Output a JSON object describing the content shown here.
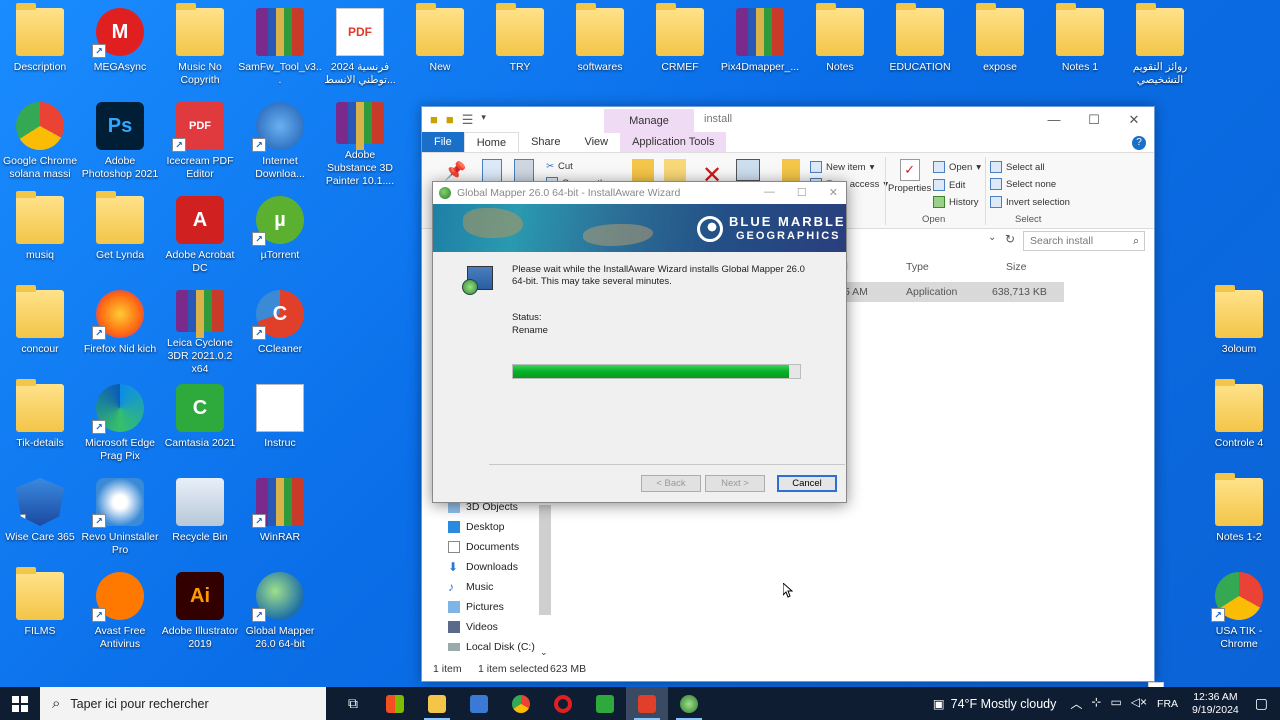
{
  "desktop": {
    "icons": [
      {
        "label": "Description",
        "kind": "folder",
        "shortcut": false
      },
      {
        "label": "MEGAsync",
        "kind": "mega",
        "shortcut": true
      },
      {
        "label": "Music No Copyrith",
        "kind": "folder",
        "shortcut": false
      },
      {
        "label": "SamFw_Tool_v3...",
        "kind": "rar",
        "shortcut": false
      },
      {
        "label": "فرنسية 2024 توطني الانسط...",
        "kind": "pdf",
        "shortcut": false
      },
      {
        "label": "New",
        "kind": "folder",
        "shortcut": false
      },
      {
        "label": "TRY",
        "kind": "folder",
        "shortcut": false
      },
      {
        "label": "softwares",
        "kind": "folder",
        "shortcut": false
      },
      {
        "label": "CRMEF",
        "kind": "folder",
        "shortcut": false
      },
      {
        "label": "Pix4Dmapper_...",
        "kind": "rar",
        "shortcut": false
      },
      {
        "label": "Notes",
        "kind": "folder",
        "shortcut": false
      },
      {
        "label": "EDUCATION",
        "kind": "folder",
        "shortcut": false
      },
      {
        "label": "expose",
        "kind": "folder",
        "shortcut": false
      },
      {
        "label": "Notes 1",
        "kind": "folder",
        "shortcut": false
      },
      {
        "label": "روائز التقويم التشخيصي",
        "kind": "folder",
        "shortcut": false
      },
      {
        "label": "Google Chrome solana massi",
        "kind": "chrome",
        "shortcut": false
      },
      {
        "label": "Adobe Photoshop 2021",
        "kind": "ps",
        "shortcut": false
      },
      {
        "label": "Icecream PDF Editor",
        "kind": "icecream",
        "shortcut": true
      },
      {
        "label": "Internet Downloa...",
        "kind": "idm",
        "shortcut": true
      },
      {
        "label": "Adobe Substance 3D Painter 10.1....",
        "kind": "rar",
        "shortcut": false
      },
      {
        "label": "musiq",
        "kind": "folder",
        "shortcut": false
      },
      {
        "label": "Get Lynda",
        "kind": "folder",
        "shortcut": false
      },
      {
        "label": "Adobe Acrobat DC",
        "kind": "acrobat",
        "shortcut": false
      },
      {
        "label": "µTorrent",
        "kind": "utorrent",
        "shortcut": true
      },
      {
        "label": "concour",
        "kind": "folder",
        "shortcut": false
      },
      {
        "label": "Firefox Nid kich",
        "kind": "firefox",
        "shortcut": true
      },
      {
        "label": "Leica Cyclone 3DR 2021.0.2 x64",
        "kind": "rar",
        "shortcut": false
      },
      {
        "label": "CCleaner",
        "kind": "ccleaner",
        "shortcut": true
      },
      {
        "label": "Tik-details",
        "kind": "folder",
        "shortcut": false
      },
      {
        "label": "Microsoft Edge Prag Pix",
        "kind": "edge",
        "shortcut": true
      },
      {
        "label": "Camtasia 2021",
        "kind": "camtasia",
        "shortcut": false
      },
      {
        "label": "Instruc",
        "kind": "doc",
        "shortcut": false
      },
      {
        "label": "Wise Care 365",
        "kind": "wise",
        "shortcut": true
      },
      {
        "label": "Revo Uninstaller Pro",
        "kind": "revo",
        "shortcut": true
      },
      {
        "label": "Recycle Bin",
        "kind": "recycle",
        "shortcut": false
      },
      {
        "label": "WinRAR",
        "kind": "rar",
        "shortcut": true
      },
      {
        "label": "FILMS",
        "kind": "folder",
        "shortcut": false
      },
      {
        "label": "Avast Free Antivirus",
        "kind": "avast",
        "shortcut": true
      },
      {
        "label": "Adobe Illustrator 2019",
        "kind": "ai",
        "shortcut": false
      },
      {
        "label": "Global Mapper 26.0 64-bit",
        "kind": "gm",
        "shortcut": true
      },
      {
        "label": "3oloum",
        "kind": "folder",
        "shortcut": false
      },
      {
        "label": "Controle 4",
        "kind": "folder",
        "shortcut": false
      },
      {
        "label": "Notes 1-2",
        "kind": "folder",
        "shortcut": false
      },
      {
        "label": "USA TIK - Chrome",
        "kind": "chrome",
        "shortcut": true
      }
    ]
  },
  "explorer": {
    "title": "install",
    "manage_tab": "Manage",
    "tabs": [
      "File",
      "Home",
      "Share",
      "View",
      "Application Tools"
    ],
    "ribbon": {
      "cut": "Cut",
      "copy_path": "Copy path",
      "new_item": "New item",
      "easy_access": "Easy access",
      "properties": "Properties",
      "open": "Open",
      "edit": "Edit",
      "history": "History",
      "open_group": "Open",
      "select_all": "Select all",
      "select_none": "Select none",
      "invert_selection": "Invert selection",
      "select_group": "Select"
    },
    "search_placeholder": "Search install",
    "columns": {
      "type": "Type",
      "size": "Size",
      "date_tail": "d"
    },
    "file": {
      "date_tail": "5 AM",
      "type": "Application",
      "size": "638,713 KB"
    },
    "nav": [
      "3D Objects",
      "Desktop",
      "Documents",
      "Downloads",
      "Music",
      "Pictures",
      "Videos",
      "Local Disk (C:)"
    ],
    "status": {
      "count": "1 item",
      "selected": "1 item selected",
      "size": "623 MB"
    }
  },
  "installer": {
    "title": "Global Mapper 26.0 64-bit - InstallAware Wizard",
    "brand_line1": "BLUE MARBLE",
    "brand_line2": "GEOGRAPHICS",
    "message": "Please wait while the InstallAware Wizard installs Global Mapper 26.0 64-bit. This may take several minutes.",
    "status_label": "Status:",
    "status_value": "Rename",
    "progress": 0.96,
    "back": "< Back",
    "next": "Next >",
    "cancel": "Cancel"
  },
  "taskbar": {
    "search_placeholder": "Taper ici pour rechercher",
    "weather": "74°F  Mostly cloudy",
    "lang": "FRA",
    "time": "12:36 AM",
    "date": "9/19/2024"
  }
}
